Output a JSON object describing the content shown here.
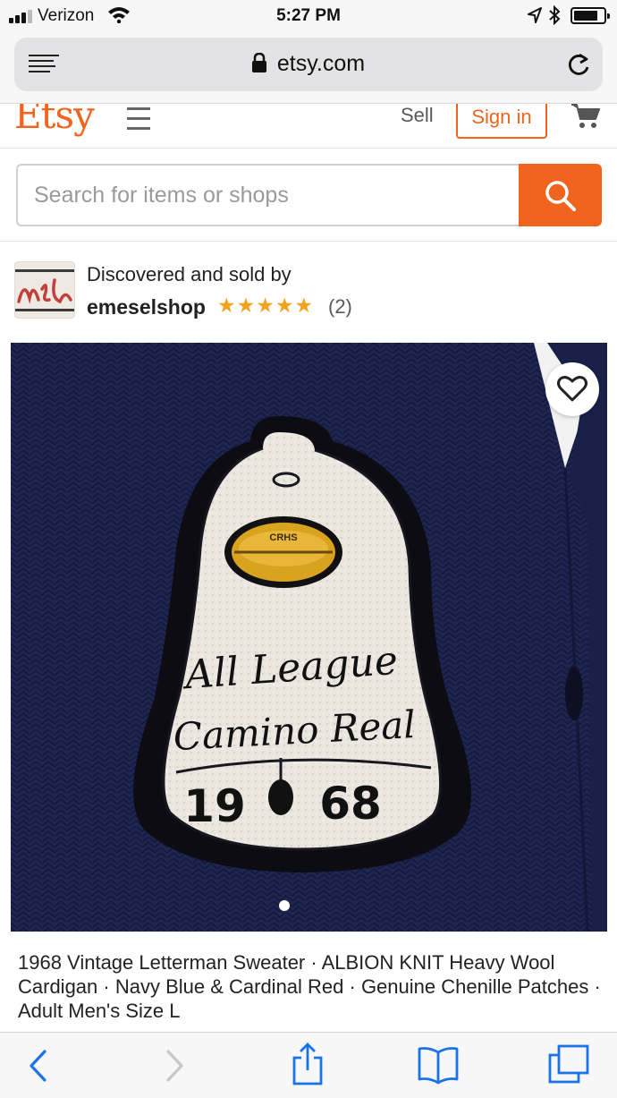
{
  "status_bar": {
    "carrier": "Verizon",
    "time": "5:27 PM",
    "signal_bars": 3,
    "battery_level": 0.8
  },
  "browser": {
    "url": "etsy.com",
    "icons": [
      "menu-icon",
      "lock-icon",
      "reload-icon"
    ]
  },
  "header": {
    "logo": "Etsy",
    "sell": "Sell",
    "sign_in": "Sign in",
    "icons": [
      "hamburger-icon",
      "cart-icon"
    ]
  },
  "search": {
    "placeholder": "Search for items or shops",
    "icon": "search-icon"
  },
  "shop": {
    "discovered_label": "Discovered and sold by",
    "name": "emeselshop",
    "rating": 5,
    "stars": "★★★★★",
    "review_count": "(2)",
    "colors": {
      "stars": "#f1a31e"
    }
  },
  "product": {
    "image_alt_colors": {
      "sweater": "#1d2550",
      "patch": "#ebe6df"
    },
    "patch_text_line1": "All League",
    "patch_text_line2": "Camino Real",
    "patch_year_left": "19",
    "patch_year_right": "68",
    "carousel_position": 1,
    "carousel_total": 1,
    "title": "1968 Vintage Letterman Sweater · ALBION KNIT Heavy Wool Cardigan · Navy Blue & Cardinal Red · Genuine Chenille Patches · Adult Men's Size L"
  },
  "theme": {
    "accent": "#f1641e"
  },
  "toolbar": {
    "icons": [
      "back-icon",
      "forward-icon",
      "share-icon",
      "bookmarks-icon",
      "tabs-icon"
    ]
  }
}
